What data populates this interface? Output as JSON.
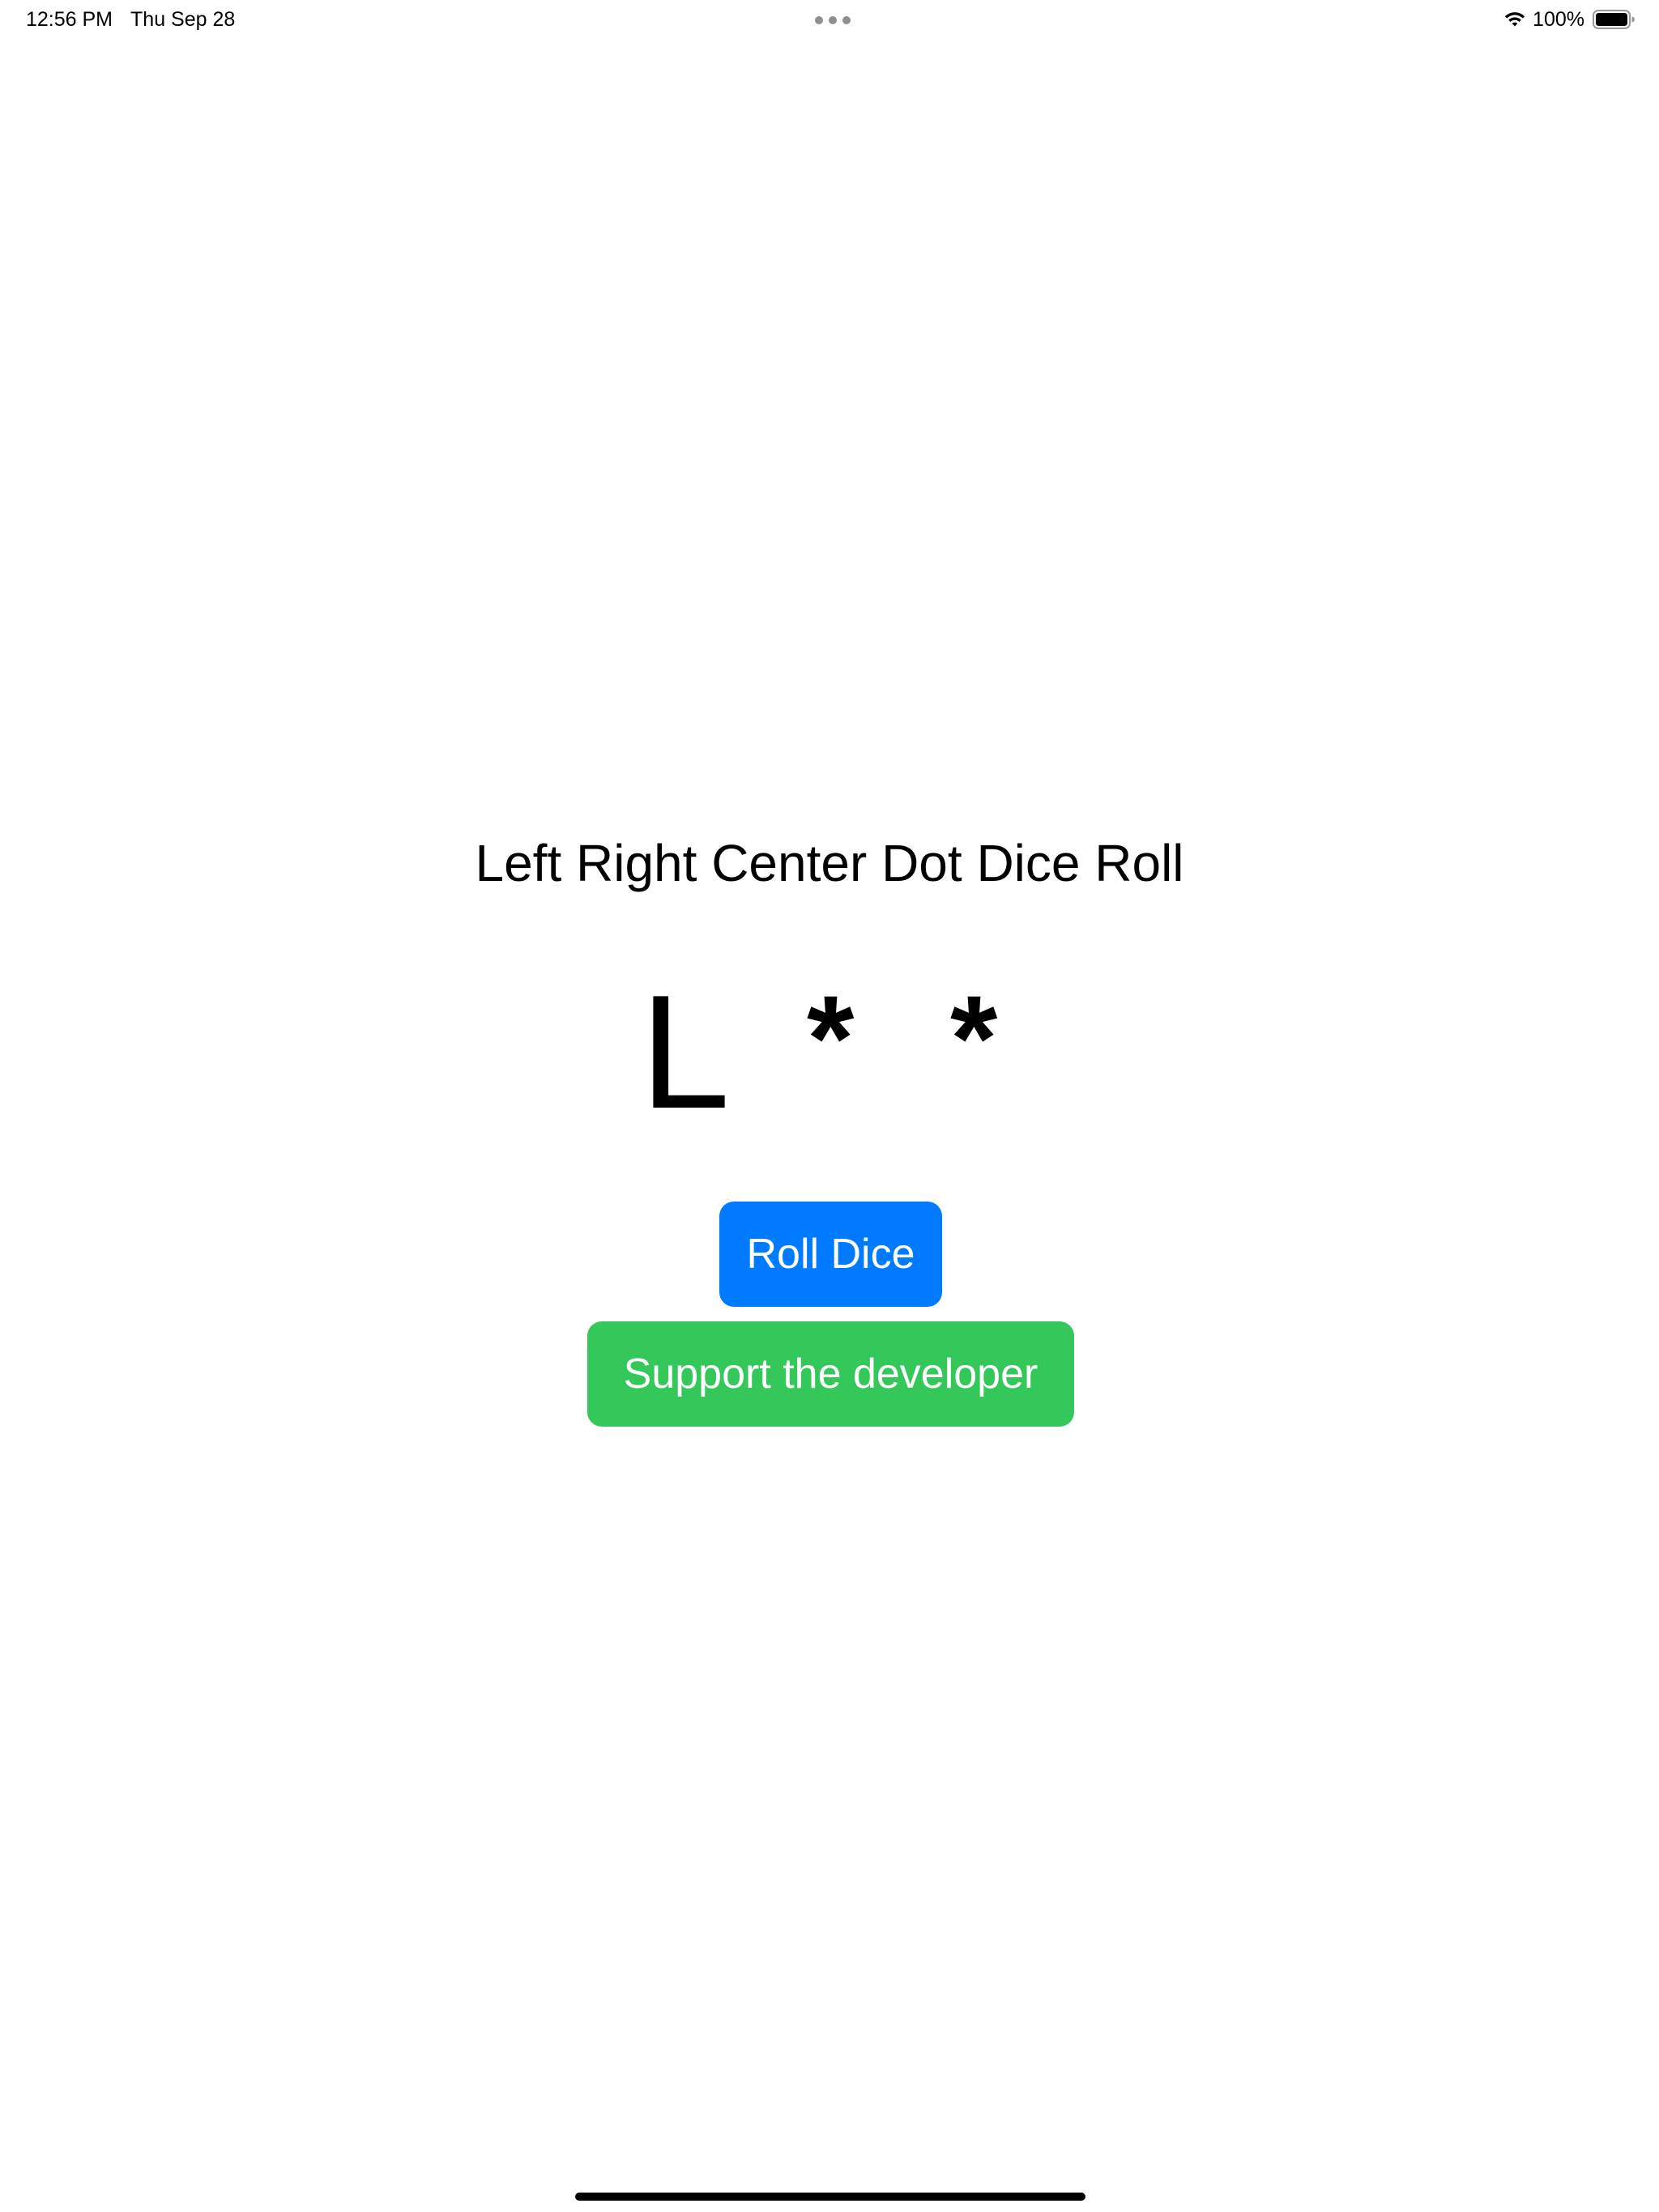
{
  "status_bar": {
    "time": "12:56 PM",
    "date": "Thu Sep 28",
    "battery_percent": "100%",
    "battery_level": 1.0,
    "icons": [
      "multitask-dots",
      "wifi-icon",
      "battery-icon"
    ]
  },
  "app": {
    "title": "Left Right Center Dot Dice Roll",
    "dice": [
      "L",
      "*",
      "*"
    ],
    "roll_button_label": "Roll Dice",
    "support_button_label": "Support the developer"
  },
  "colors": {
    "roll_button": "#007aff",
    "support_button": "#34c759",
    "text": "#000000",
    "background": "#ffffff"
  }
}
